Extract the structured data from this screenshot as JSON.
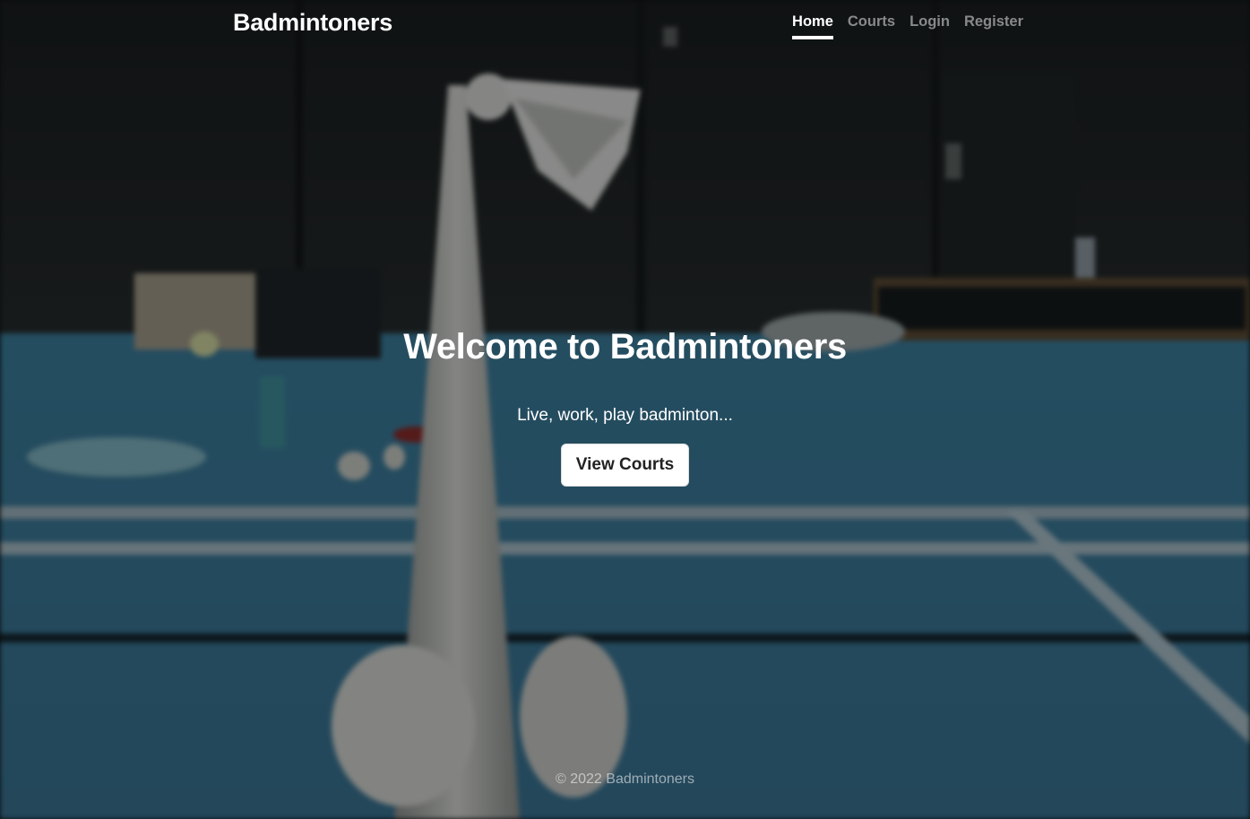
{
  "header": {
    "brand": "Badmintoners",
    "nav": [
      {
        "label": "Home",
        "active": true
      },
      {
        "label": "Courts",
        "active": false
      },
      {
        "label": "Login",
        "active": false
      },
      {
        "label": "Register",
        "active": false
      }
    ]
  },
  "hero": {
    "title": "Welcome to Badmintoners",
    "lead": "Live, work, play badminton...",
    "button_label": "View Courts"
  },
  "footer": {
    "copyright": "© 2022 Badmintoners"
  },
  "colors": {
    "text": "#ffffff",
    "nav_inactive": "rgba(255,255,255,0.5)",
    "button_bg": "#ffffff",
    "button_text": "#222222",
    "court_floor": "#2c5f7c",
    "wall": "#111617"
  }
}
